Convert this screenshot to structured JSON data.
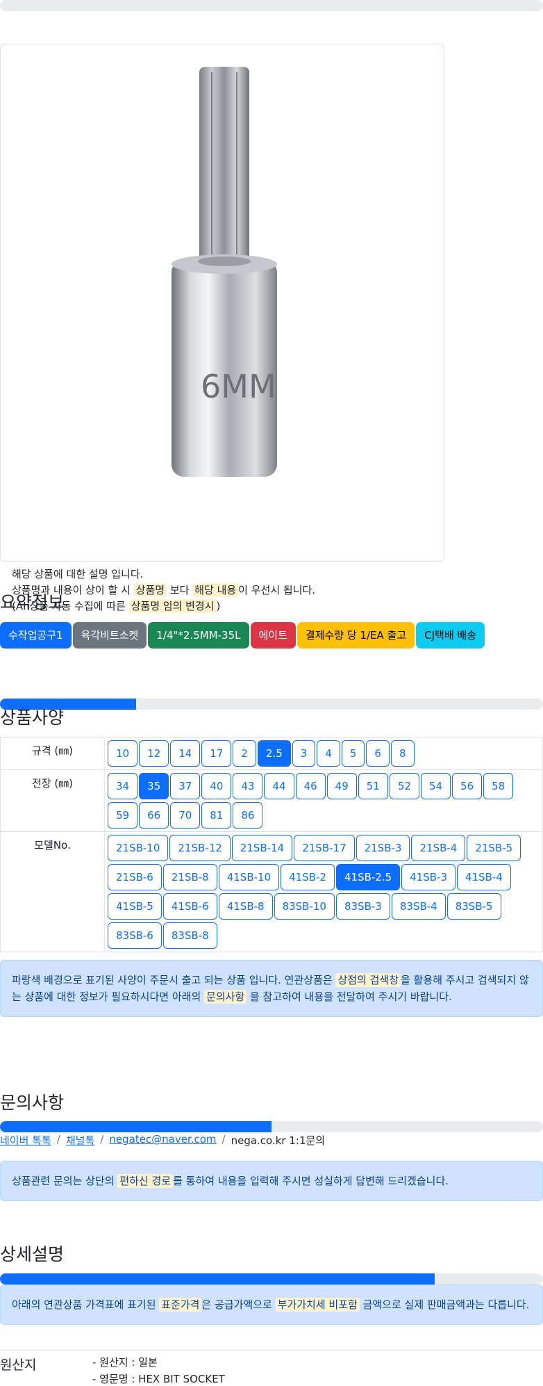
{
  "description": {
    "line1": "해당 상품에 대한 설명 입니다.",
    "line2_a": "상품명과 내용이 상이 할 시 ",
    "line2_hl1": "상품명",
    "line2_b": " 보다 ",
    "line2_hl2": "해당 내용",
    "line2_c": "이 우선시 됩니다.",
    "line3_a": "(AI 상품 자동 수집에 따른 ",
    "line3_hl": "상품명 임의 변경시",
    "line3_b": ")"
  },
  "image_text": "6MM",
  "summary": {
    "title": "요약정보",
    "badges": [
      "수작업공구1",
      "육각비트소켓",
      "1/4\"*2.5MM-35L",
      "에이트",
      "결제수량 당 1/EA 출고",
      "CJ택배 배송"
    ],
    "badge_colors": [
      "#0d6efd",
      "#6c757d",
      "#198754",
      "#dc3545",
      "#ffc107",
      "#0dcaf0"
    ]
  },
  "spec": {
    "title": "상품사양",
    "progress": 0.25,
    "rows": [
      {
        "label": "규격 (㎜)",
        "options": [
          "10",
          "12",
          "14",
          "17",
          "2",
          "2.5",
          "3",
          "4",
          "5",
          "6",
          "8"
        ],
        "selected": "2.5"
      },
      {
        "label": "전장 (㎜)",
        "options": [
          "34",
          "35",
          "37",
          "40",
          "43",
          "44",
          "46",
          "49",
          "51",
          "52",
          "54",
          "56",
          "58",
          "59",
          "66",
          "70",
          "81",
          "86"
        ],
        "selected": "35"
      },
      {
        "label": "모델No.",
        "options": [
          "21SB-10",
          "21SB-12",
          "21SB-14",
          "21SB-17",
          "21SB-3",
          "21SB-4",
          "21SB-5",
          "21SB-6",
          "21SB-8",
          "41SB-10",
          "41SB-2",
          "41SB-2.5",
          "41SB-3",
          "41SB-4",
          "41SB-5",
          "41SB-6",
          "41SB-8",
          "83SB-10",
          "83SB-3",
          "83SB-4",
          "83SB-5",
          "83SB-6",
          "83SB-8"
        ],
        "selected": "41SB-2.5"
      }
    ],
    "notice_a": "파랑색 배경으로 표기된 사양이 주문시 출고 되는 상품 입니다. 연관상품은 ",
    "notice_hl1": "상점의 검색창",
    "notice_b": "을 활용해 주시고 검색되지 않는 상품에 대한 정보가 필요하시다면 아래의 ",
    "notice_hl2": "문의사항",
    "notice_c": " 을 참고하여 내용을 전달하여 주시기 바랍니다."
  },
  "inquiry": {
    "title": "문의사항",
    "progress": 0.5,
    "links": [
      "네이버 톡톡",
      "채널톡",
      "negatec@naver.com"
    ],
    "plain": "nega.co.kr 1:1문의",
    "separator": "/",
    "notice_a": "상품관련 문의는 상단의 ",
    "notice_hl": "편하신 경로",
    "notice_b": "를 통하여 내용을 입력해 주시면 성실하게 답변해 드리겠습니다."
  },
  "detail": {
    "title": "상세설명",
    "progress": 0.8,
    "notice_a": "아래의 연관상품 가격표에 표기된 ",
    "notice_hl1": "표준가격",
    "notice_b": "은 공급가액으로 ",
    "notice_hl2": "부가가치세 비포함",
    "notice_c": " 금액으로 실제 판매금액과는 다릅니다."
  },
  "origin": {
    "label": "원산지",
    "line1": "- 원산지 : 일본",
    "line2": "- 영문명 : HEX BIT SOCKET"
  }
}
